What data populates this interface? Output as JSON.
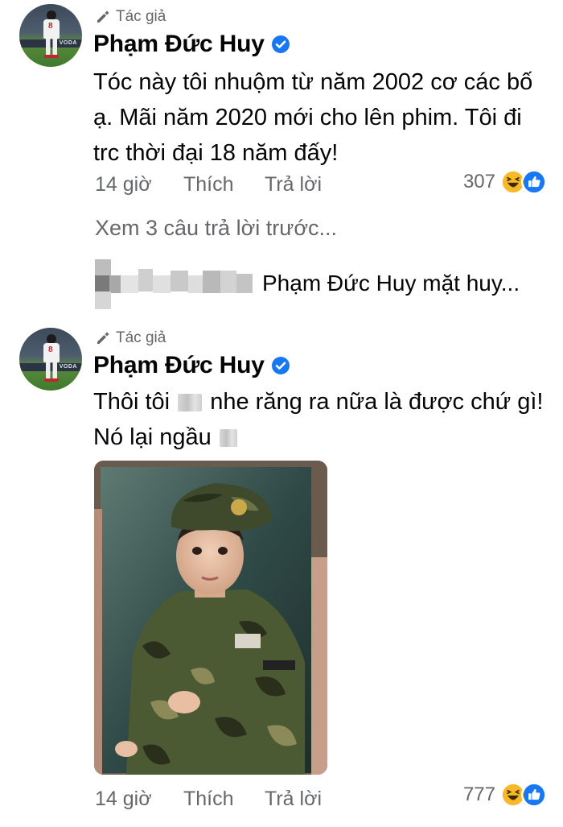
{
  "comments": [
    {
      "author_badge": "Tác giả",
      "name": "Phạm Đức Huy",
      "text": "Tóc này tôi nhuộm từ năm 2002 cơ các bố ạ. Mãi năm 2020 mới cho lên phim. Tôi đi trc thời đại 18 năm đấy!",
      "time": "14 giờ",
      "like_label": "Thích",
      "reply_label": "Trả lời",
      "reaction_count": "307",
      "see_replies": "Xem 3 câu trả lời trước...",
      "reply_preview": "Phạm Đức Huy mặt huy..."
    },
    {
      "author_badge": "Tác giả",
      "name": "Phạm Đức Huy",
      "text_part1": "Thôi tôi",
      "text_part2": "nhe răng ra nữa là được chứ gì! Nó lại ngầu",
      "time": "14 giờ",
      "like_label": "Thích",
      "reply_label": "Trả lời",
      "reaction_count": "777"
    }
  ],
  "avatar_banner_text": "VODA",
  "player_number": "8",
  "icons": {
    "author_badge": "pencil-icon",
    "verified": "verified-badge-icon",
    "reactions": [
      "haha-reaction-icon",
      "like-reaction-icon"
    ]
  },
  "colors": {
    "text_primary": "#050505",
    "text_secondary": "#65676b",
    "verified_blue": "#1877f2",
    "haha_yellow": "#f7b928"
  }
}
